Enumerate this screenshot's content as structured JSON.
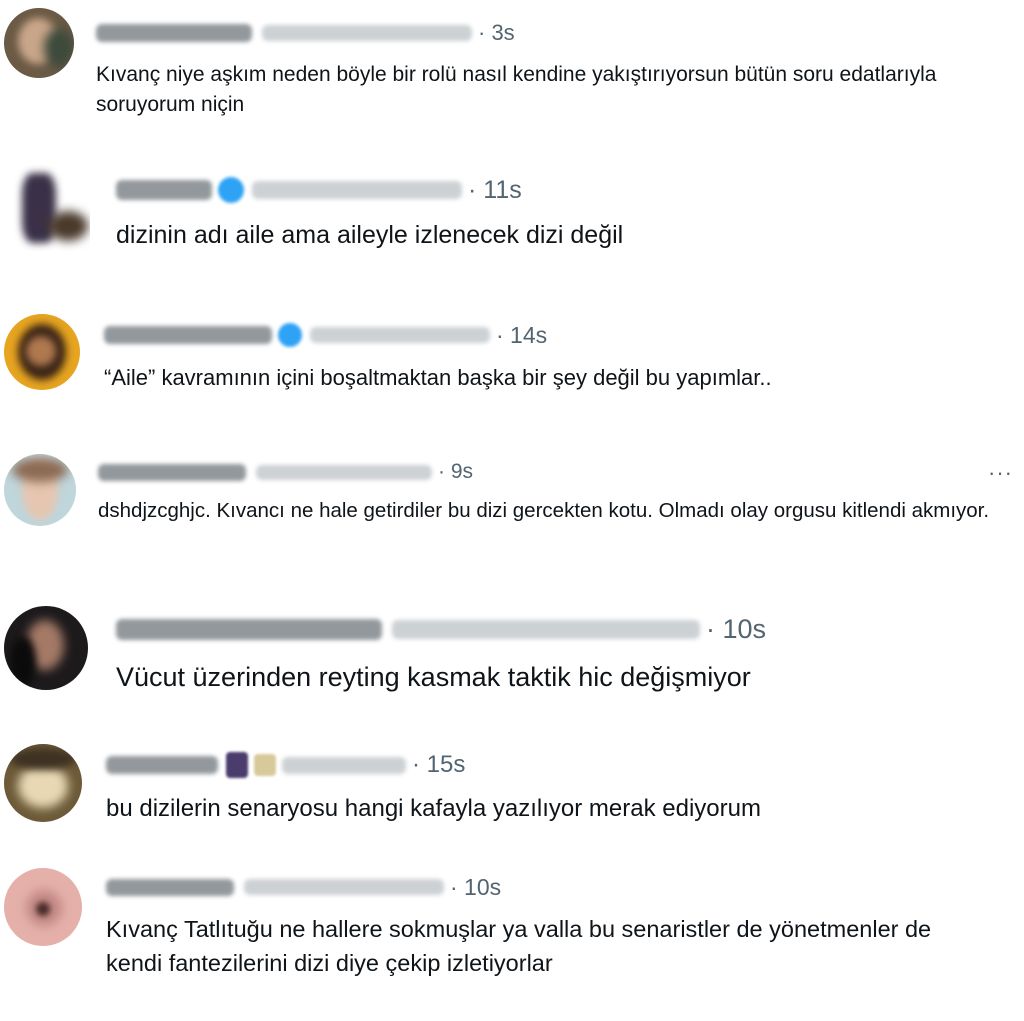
{
  "replies": [
    {
      "time": "· 3s",
      "text": "Kıvanç niye aşkım neden böyle bir rolü nasıl kendine yakıştırıyorsun bütün soru edatlarıyla soruyorum niçin"
    },
    {
      "time": "· 11s",
      "text": "dizinin adı aile ama aileyle izlenecek dizi değil"
    },
    {
      "time": "· 14s",
      "text": "“Aile” kavramının içini boşaltmaktan başka bir şey değil bu yapımlar.."
    },
    {
      "time": "· 9s",
      "text": "dshdjzcghjc. Kıvancı ne hale getirdiler bu dizi gercekten kotu. Olmadı olay orgusu kitlendi akmıyor.",
      "more": "···"
    },
    {
      "time": "· 10s",
      "text": "Vücut üzerinden reyting kasmak taktik hic değişmiyor"
    },
    {
      "time": "· 15s",
      "text": "bu dizilerin senaryosu hangi kafayla yazılıyor merak ediyorum"
    },
    {
      "time": "· 10s",
      "text": "Kıvanç Tatlıtuğu ne hallere sokmuşlar ya valla bu senaristler de yönetmenler de kendi fantezilerini dizi diye çekip izletiyorlar"
    }
  ]
}
